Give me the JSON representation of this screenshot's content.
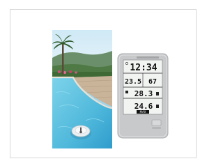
{
  "product": {
    "display": {
      "time": "12:34",
      "temp_1": "23.5",
      "humidity": "67",
      "temp_2": "28.3",
      "temp_3": "24.6",
      "max_label": "MAX"
    },
    "pool_sensor_icon": "thermometer-icon",
    "colors": {
      "station_body": "#c7c9cb",
      "lcd": "#f2f4f2",
      "sky": "#bfe3f5",
      "pool_water": "#5fc3e0"
    }
  }
}
